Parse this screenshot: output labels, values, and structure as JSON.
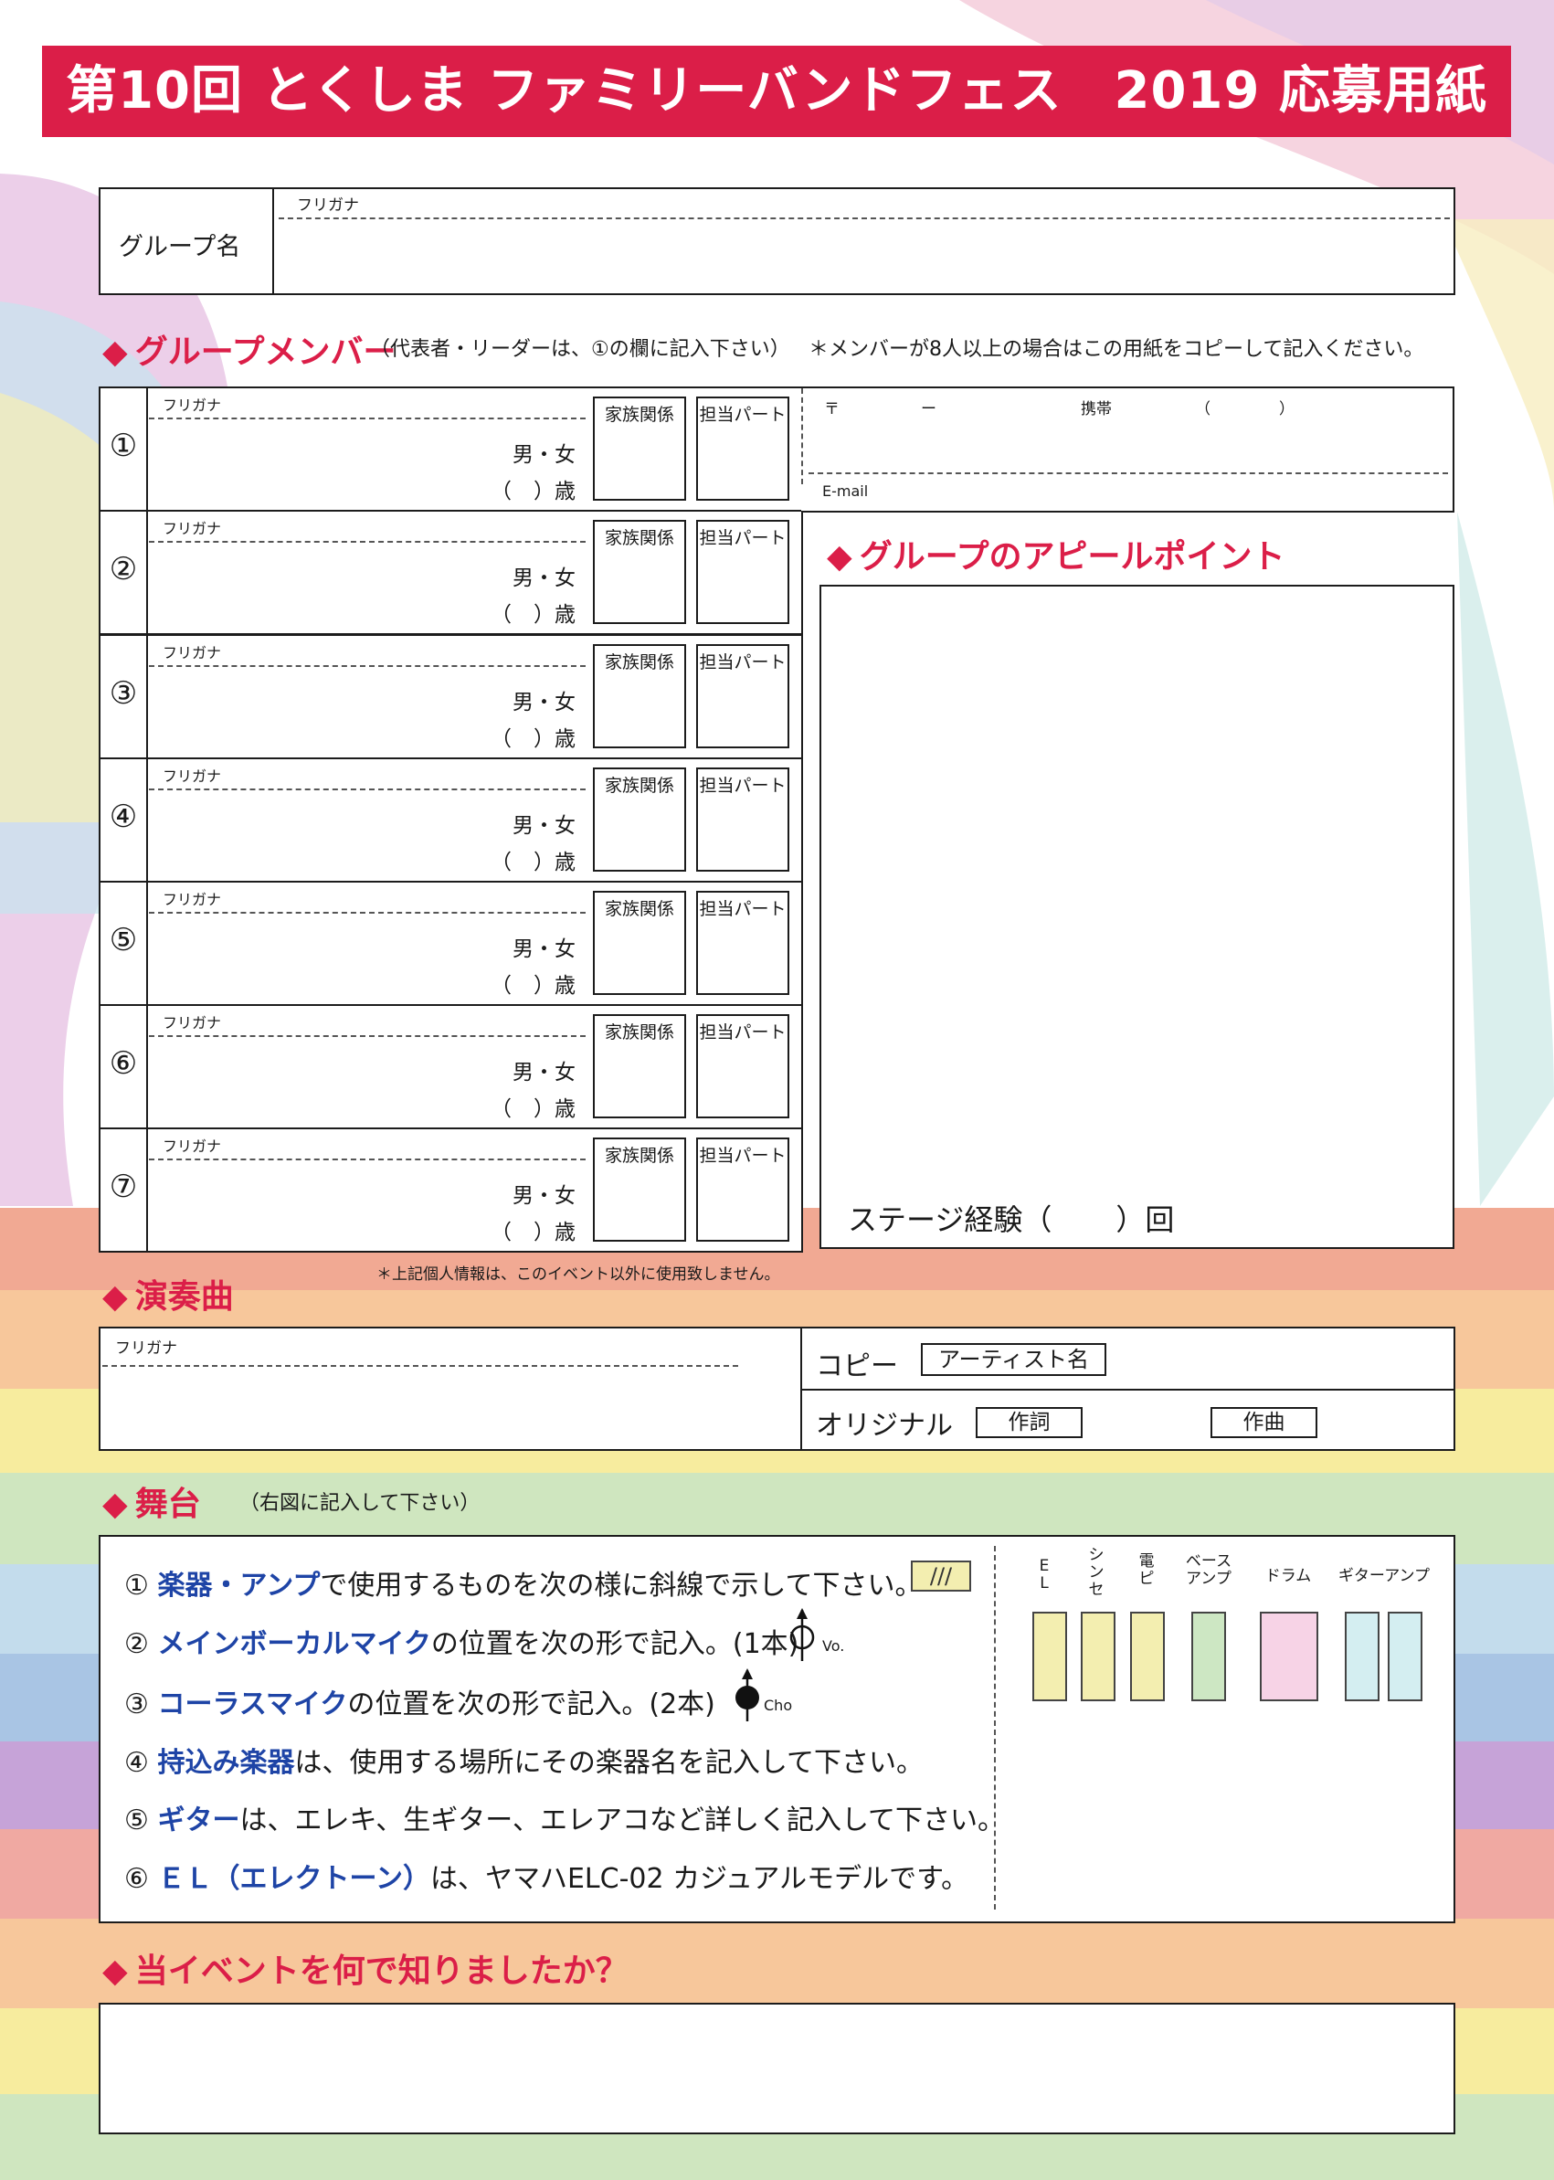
{
  "title": "第10回 とくしま ファミリーバンドフェス　2019 応募用紙",
  "group_name": {
    "label": "グループ名",
    "furigana": "フリガナ"
  },
  "members_section": {
    "title": "グループメンバー",
    "note1": "（代表者・リーダーは、①の欄に記入下さい）",
    "note2": "＊メンバーが8人以上の場合はこの用紙をコピーして記入ください。",
    "furigana": "フリガナ",
    "gender": "男・女",
    "age_open": "（",
    "age_close": "）歳",
    "family": "家族関係",
    "part": "担当パート",
    "numbers": [
      "①",
      "②",
      "③",
      "④",
      "⑤",
      "⑥",
      "⑦"
    ],
    "privacy": "＊上記個人情報は、このイベント以外に使用致しません。"
  },
  "contact": {
    "postal": "〒",
    "dash": "ー",
    "mobile": "携帯",
    "paren_open": "（",
    "paren_close": "）",
    "email": "E-mail"
  },
  "appeal": {
    "title": "グループのアピールポイント",
    "stage_label": "ステージ経験（",
    "stage_suffix": "）回"
  },
  "song": {
    "title": "演奏曲",
    "furigana": "フリガナ",
    "copy": "コピー",
    "artist": "アーティスト名",
    "original": "オリジナル",
    "lyrics": "作詞",
    "music": "作曲"
  },
  "stage": {
    "title": "舞台",
    "note": "（右図に記入して下さい）",
    "items": [
      {
        "num": "①",
        "key": "楽器・アンプ",
        "text": "で使用するものを次の様に斜線で示して下さい。"
      },
      {
        "num": "②",
        "key": "メインボーカルマイク",
        "text": "の位置を次の形で記入。(1本)"
      },
      {
        "num": "③",
        "key": "コーラスマイク",
        "text": "の位置を次の形で記入。(2本)"
      },
      {
        "num": "④",
        "key": "持込み楽器",
        "text": "は、使用する場所にその楽器名を記入して下さい。"
      },
      {
        "num": "⑤",
        "key": "ギター",
        "text": "は、エレキ、生ギター、エレアコなど詳しく記入して下さい。"
      },
      {
        "num": "⑥",
        "key": "ＥＬ（エレクトーン）",
        "text": "は、ヤマハELC-02 カジュアルモデルです。"
      }
    ],
    "slash_sample": "///",
    "vo": "Vo.",
    "cho": "Cho",
    "legend": {
      "el1": "E",
      "el2": "L",
      "synth1": "シ",
      "synth2": "ン",
      "synth3": "セ",
      "piano1": "電",
      "piano2": "ピ",
      "bass1": "ベース",
      "bass2": "アンプ",
      "drum": "ドラム",
      "gamp": "ギターアンプ"
    },
    "colors": {
      "keys": "#f3eeb0",
      "bass": "#cde7c3",
      "drum": "#f7d3e6",
      "gamp": "#d4eef1"
    }
  },
  "source": {
    "title": "当イベントを何で知りましたか？"
  }
}
